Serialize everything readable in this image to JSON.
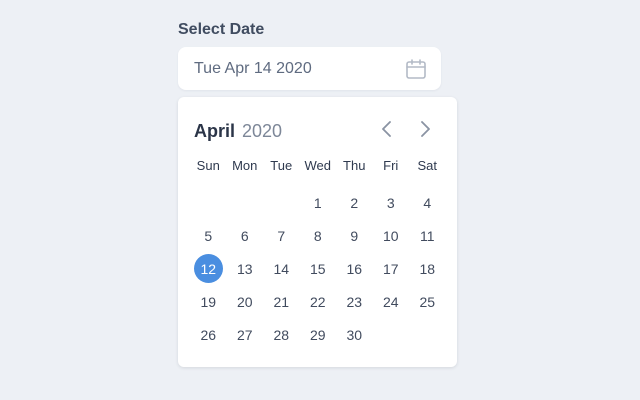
{
  "field": {
    "label": "Select Date",
    "value": "Tue Apr 14 2020",
    "icon": "calendar-icon"
  },
  "calendar": {
    "month": "April",
    "year": "2020",
    "prev_icon": "chevron-left-icon",
    "next_icon": "chevron-right-icon",
    "weekdays": [
      "Sun",
      "Mon",
      "Tue",
      "Wed",
      "Thu",
      "Fri",
      "Sat"
    ],
    "leading_blanks": 3,
    "days": [
      "1",
      "2",
      "3",
      "4",
      "5",
      "6",
      "7",
      "8",
      "9",
      "10",
      "11",
      "12",
      "13",
      "14",
      "15",
      "16",
      "17",
      "18",
      "19",
      "20",
      "21",
      "22",
      "23",
      "24",
      "25",
      "26",
      "27",
      "28",
      "29",
      "30"
    ],
    "selected_day": "12",
    "accent_color": "#4a8ee0"
  }
}
